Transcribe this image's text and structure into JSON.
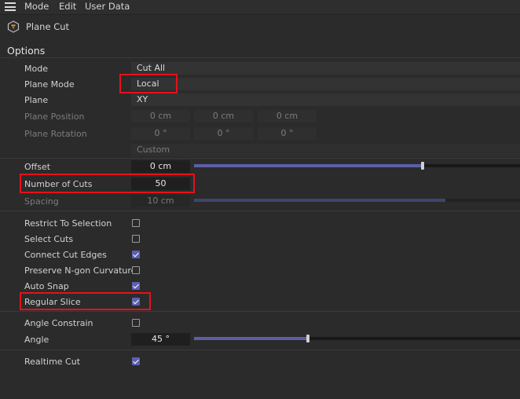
{
  "menubar": {
    "items": [
      "Mode",
      "Edit",
      "User Data"
    ]
  },
  "tool": {
    "title": "Plane Cut",
    "icon": "plane-cut-tool-icon"
  },
  "section": {
    "title": "Options"
  },
  "params": {
    "mode": {
      "label": "Mode",
      "value": "Cut All"
    },
    "plane_mode": {
      "label": "Plane Mode",
      "value": "Local"
    },
    "plane": {
      "label": "Plane",
      "value": "XY"
    },
    "plane_position": {
      "label": "Plane Position",
      "x": "0 cm",
      "y": "0 cm",
      "z": "0 cm"
    },
    "plane_rotation": {
      "label": "Plane Rotation",
      "h": "0 °",
      "p": "0 °",
      "b": "0 °"
    },
    "custom": {
      "value": "Custom"
    },
    "offset": {
      "label": "Offset",
      "value": "0 cm",
      "slider_fraction": 0.7
    },
    "number_of_cuts": {
      "label": "Number of Cuts",
      "value": "50"
    },
    "spacing": {
      "label": "Spacing",
      "value": "10 cm",
      "slider_fraction": 0.77
    },
    "restrict_to_selection": {
      "label": "Restrict To Selection",
      "checked": false
    },
    "select_cuts": {
      "label": "Select Cuts",
      "checked": false
    },
    "connect_cut_edges": {
      "label": "Connect Cut Edges",
      "checked": true
    },
    "preserve_ngon": {
      "label": "Preserve N-gon Curvature",
      "checked": false
    },
    "auto_snap": {
      "label": "Auto Snap",
      "checked": true
    },
    "regular_slice": {
      "label": "Regular Slice",
      "checked": true
    },
    "angle_constrain": {
      "label": "Angle Constrain",
      "checked": false
    },
    "angle": {
      "label": "Angle",
      "value": "45 °",
      "slider_fraction": 0.35
    },
    "realtime_cut": {
      "label": "Realtime Cut",
      "checked": true
    }
  },
  "colors": {
    "accent": "#5d61b0",
    "highlight": "#e8101a",
    "background": "#2b2b2b"
  }
}
